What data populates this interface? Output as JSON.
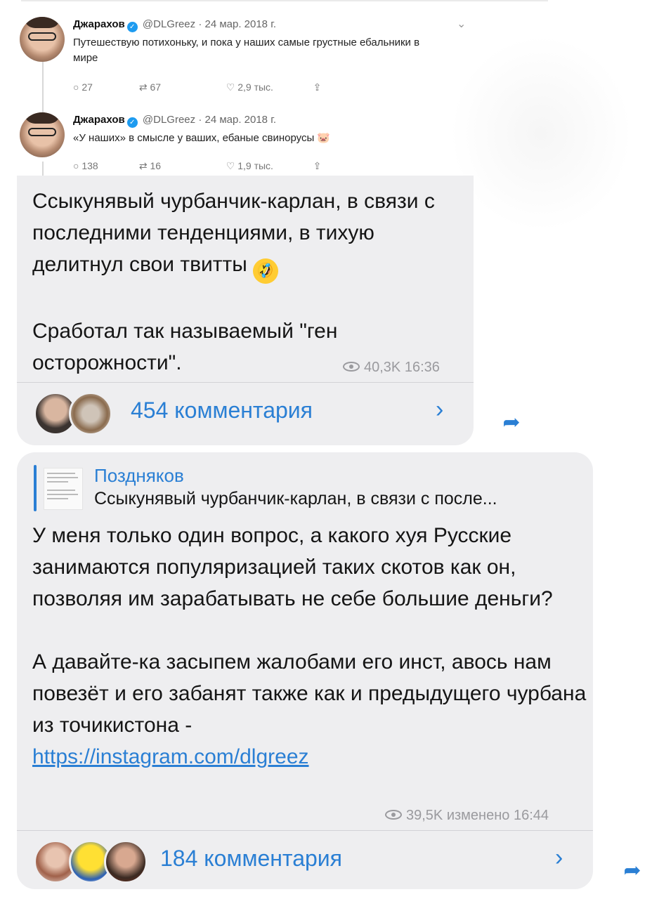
{
  "tweets": [
    {
      "name": "Джарахов",
      "handle": "@DLGreez",
      "date": "· 24 мар. 2018 г.",
      "text": "Путешествую потихоньку, и пока у наших самые грустные ебальники в мире",
      "replies": "27",
      "retweets": "67",
      "likes": "2,9 тыс."
    },
    {
      "name": "Джарахов",
      "handle": "@DLGreez",
      "date": "· 24 мар. 2018 г.",
      "text": "«У наших» в смысле у ваших, ебаные свинорусы 🐷",
      "replies": "138",
      "retweets": "16",
      "likes": "1,9 тыс."
    }
  ],
  "post1": {
    "text_a": "Ссыкунявый чурбанчик-карлан, в связи с последними тенденциями, в тихую делитнул свои твитты",
    "emoji": "🤣",
    "text_b": "Сработал так называемый \"ген осторожности\".",
    "views": "40,3K",
    "time": "16:36",
    "comments": "454 комментария"
  },
  "post2": {
    "reply_to_name": "Поздняков",
    "reply_to_text": "Ссыкунявый чурбанчик-карлан, в связи с после...",
    "text_a": "У меня только один вопрос, а какого хуя Русские занимаются популяризацией таких скотов как он, позволяя им зарабатывать не себе большие деньги?",
    "text_b": "А давайте-ка засыпем жалобами его инст, авось нам повезёт и его забанят также как и предыдущего чурбана из точикистона -",
    "link": "https://instagram.com/dlgreez",
    "views": "39,5K",
    "edited": "изменено",
    "time": "16:44",
    "comments": "184 комментария"
  },
  "icons": {
    "reply": "reply-icon",
    "retweet": "retweet-icon",
    "like": "heart-icon",
    "share": "share-icon",
    "views": "eye-icon",
    "forward": "forward-icon"
  },
  "colors": {
    "accent": "#2a7fd4",
    "bubble": "#eeeef0",
    "verified": "#1d9bf0"
  }
}
